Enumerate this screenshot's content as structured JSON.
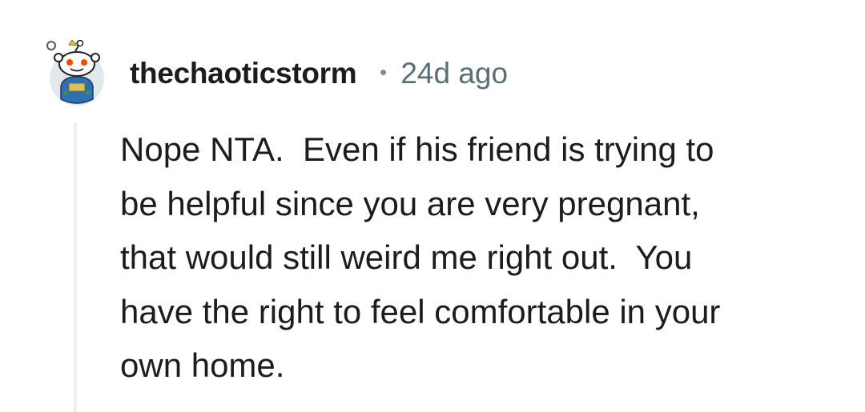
{
  "comment": {
    "author": {
      "username": "thechaoticstorm",
      "avatar_icon": "snoo-avatar-icon"
    },
    "timestamp": "24d ago",
    "body_lines": [
      "Nope NTA.  Even if his friend is trying to",
      "be helpful since you are very pregnant,",
      "that would still weird me right out.  You",
      "have the right to feel comfortable in your",
      "own home."
    ]
  },
  "colors": {
    "text_primary": "#1c1c1c",
    "text_meta": "#576f76",
    "thread_line": "#edeff1",
    "background": "#ffffff"
  }
}
